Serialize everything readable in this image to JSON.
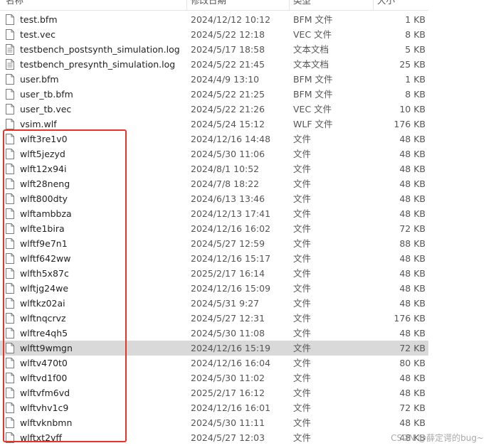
{
  "columns": {
    "name": "名称",
    "date": "修改日期",
    "type": "类型",
    "size": "大小"
  },
  "files": [
    {
      "name": "test.bfm",
      "date": "2024/12/12 10:12",
      "type": "BFM 文件",
      "size": "1 KB",
      "icon": "file-icon"
    },
    {
      "name": "test.vec",
      "date": "2024/5/22 12:18",
      "type": "VEC 文件",
      "size": "8 KB",
      "icon": "file-icon"
    },
    {
      "name": "testbench_postsynth_simulation.log",
      "date": "2024/5/17 18:58",
      "type": "文本文档",
      "size": "5 KB",
      "icon": "text-file-icon"
    },
    {
      "name": "testbench_presynth_simulation.log",
      "date": "2024/5/22 21:45",
      "type": "文本文档",
      "size": "25 KB",
      "icon": "text-file-icon"
    },
    {
      "name": "user.bfm",
      "date": "2024/4/9 13:10",
      "type": "BFM 文件",
      "size": "1 KB",
      "icon": "file-icon"
    },
    {
      "name": "user_tb.bfm",
      "date": "2024/5/22 21:25",
      "type": "BFM 文件",
      "size": "8 KB",
      "icon": "file-icon"
    },
    {
      "name": "user_tb.vec",
      "date": "2024/5/22 21:26",
      "type": "VEC 文件",
      "size": "10 KB",
      "icon": "file-icon"
    },
    {
      "name": "vsim.wlf",
      "date": "2024/5/24 15:12",
      "type": "WLF 文件",
      "size": "176 KB",
      "icon": "file-icon"
    },
    {
      "name": "wlft3re1v0",
      "date": "2024/12/16 14:48",
      "type": "文件",
      "size": "48 KB",
      "icon": "file-icon"
    },
    {
      "name": "wlft5jezyd",
      "date": "2024/5/30 11:06",
      "type": "文件",
      "size": "48 KB",
      "icon": "file-icon"
    },
    {
      "name": "wlft12x94i",
      "date": "2024/8/1 10:52",
      "type": "文件",
      "size": "48 KB",
      "icon": "file-icon"
    },
    {
      "name": "wlft28neng",
      "date": "2024/7/8 18:22",
      "type": "文件",
      "size": "48 KB",
      "icon": "file-icon"
    },
    {
      "name": "wlft800dty",
      "date": "2024/6/13 13:46",
      "type": "文件",
      "size": "48 KB",
      "icon": "file-icon"
    },
    {
      "name": "wlftambbza",
      "date": "2024/12/13 17:41",
      "type": "文件",
      "size": "48 KB",
      "icon": "file-icon"
    },
    {
      "name": "wlfte1bira",
      "date": "2024/12/16 16:02",
      "type": "文件",
      "size": "72 KB",
      "icon": "file-icon"
    },
    {
      "name": "wlftf9e7n1",
      "date": "2024/5/27 12:59",
      "type": "文件",
      "size": "88 KB",
      "icon": "file-icon"
    },
    {
      "name": "wlftf642ww",
      "date": "2024/12/16 15:17",
      "type": "文件",
      "size": "48 KB",
      "icon": "file-icon"
    },
    {
      "name": "wlfth5x87c",
      "date": "2025/2/17 16:14",
      "type": "文件",
      "size": "48 KB",
      "icon": "file-icon"
    },
    {
      "name": "wlftjg24we",
      "date": "2024/12/16 15:09",
      "type": "文件",
      "size": "48 KB",
      "icon": "file-icon"
    },
    {
      "name": "wlftkz02ai",
      "date": "2024/5/31 9:27",
      "type": "文件",
      "size": "48 KB",
      "icon": "file-icon"
    },
    {
      "name": "wlftnqcrvz",
      "date": "2024/5/27 12:31",
      "type": "文件",
      "size": "176 KB",
      "icon": "file-icon"
    },
    {
      "name": "wlftre4qh5",
      "date": "2024/5/30 11:08",
      "type": "文件",
      "size": "48 KB",
      "icon": "file-icon"
    },
    {
      "name": "wlftt9wmgn",
      "date": "2024/12/16 15:19",
      "type": "文件",
      "size": "72 KB",
      "icon": "file-icon",
      "selected": true
    },
    {
      "name": "wlftv470t0",
      "date": "2024/12/16 16:04",
      "type": "文件",
      "size": "80 KB",
      "icon": "file-icon"
    },
    {
      "name": "wlftvd1f00",
      "date": "2024/5/30 11:02",
      "type": "文件",
      "size": "48 KB",
      "icon": "file-icon"
    },
    {
      "name": "wlftvfm6vd",
      "date": "2025/2/17 16:12",
      "type": "文件",
      "size": "48 KB",
      "icon": "file-icon"
    },
    {
      "name": "wlftvhv1c9",
      "date": "2024/12/16 16:01",
      "type": "文件",
      "size": "72 KB",
      "icon": "file-icon"
    },
    {
      "name": "wlftvknbmn",
      "date": "2024/5/30 11:11",
      "type": "文件",
      "size": "48 KB",
      "icon": "file-icon"
    },
    {
      "name": "wlftxt2vff",
      "date": "2024/5/27 12:03",
      "type": "文件",
      "size": "48 KB",
      "icon": "file-icon"
    }
  ],
  "colors": {
    "selected_row": "#d9d9d9",
    "highlight_box": "#e8332b"
  },
  "watermark": "CSDN @薛定谔的bug~"
}
